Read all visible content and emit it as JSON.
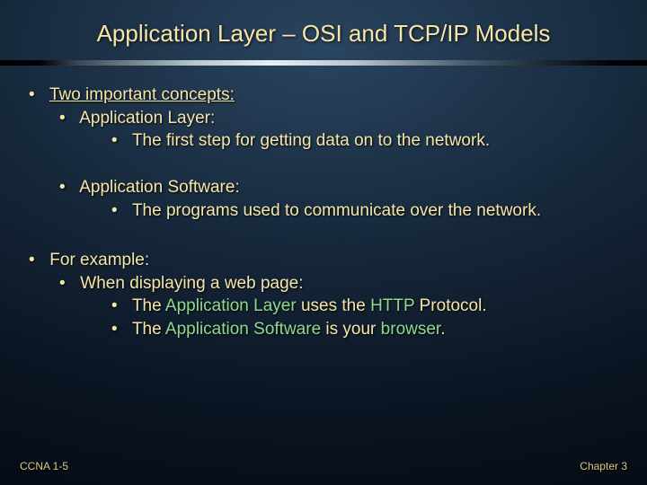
{
  "title": "Application Layer – OSI and TCP/IP Models",
  "b1": {
    "heading": "Two important concepts:",
    "item1": {
      "label": "Application Layer:",
      "detail": "The first step for getting data on to the network."
    },
    "item2": {
      "label": "Application Software:",
      "detail": "The programs used to communicate over the network."
    }
  },
  "b2": {
    "heading": "For example:",
    "sub": "When displaying a web page:",
    "line1": {
      "pre": "The ",
      "g": "Application Layer",
      "mid": " uses the ",
      "g2": "HTTP",
      "post": " Protocol."
    },
    "line2": {
      "pre": "The ",
      "g": "Application Software",
      "mid": " is your ",
      "g2": "browser",
      "post": "."
    }
  },
  "footer": {
    "left": "CCNA 1-5",
    "right": "Chapter 3"
  }
}
